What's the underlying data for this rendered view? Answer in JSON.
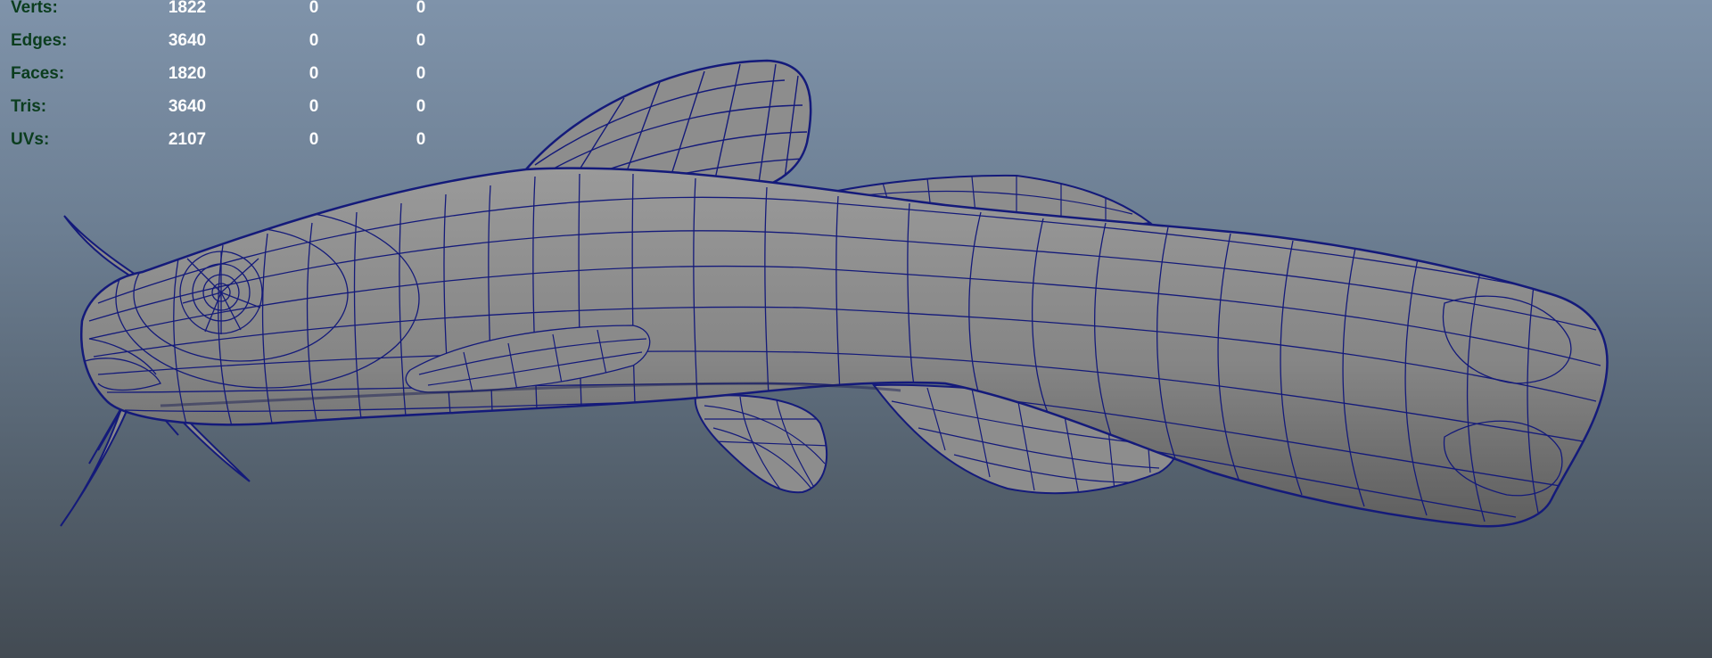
{
  "poly_count": {
    "rows": [
      {
        "label": "Verts:",
        "values": [
          "1822",
          "0",
          "0"
        ]
      },
      {
        "label": "Edges:",
        "values": [
          "3640",
          "0",
          "0"
        ]
      },
      {
        "label": "Faces:",
        "values": [
          "1820",
          "0",
          "0"
        ]
      },
      {
        "label": "Tris:",
        "values": [
          "3640",
          "0",
          "0"
        ]
      },
      {
        "label": "UVs:",
        "values": [
          "2107",
          "0",
          "0"
        ]
      }
    ]
  },
  "colors": {
    "wireframe": "#141a7a",
    "mesh_fill": "#8a8a8a",
    "stat_label": "#0b3d1e",
    "stat_value": "#ffffff"
  },
  "model": {
    "icon": "fish-mesh-icon",
    "display_mode": "wireframe-on-shaded"
  }
}
